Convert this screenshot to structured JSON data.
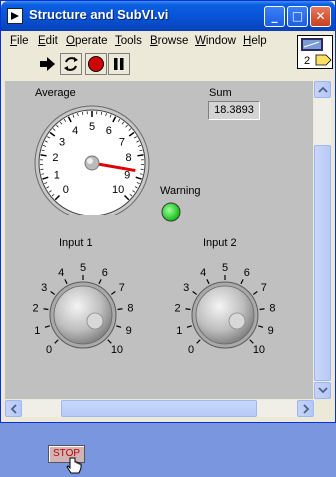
{
  "window": {
    "title": "Structure and SubVI.vi"
  },
  "title_buttons": {
    "minimize": "_",
    "maximize": "□",
    "close": "✕"
  },
  "menu": [
    {
      "label": "File",
      "accel": "F"
    },
    {
      "label": "Edit",
      "accel": "E"
    },
    {
      "label": "Operate",
      "accel": "O"
    },
    {
      "label": "Tools",
      "accel": "T"
    },
    {
      "label": "Browse",
      "accel": "B"
    },
    {
      "label": "Window",
      "accel": "W"
    },
    {
      "label": "Help",
      "accel": "H"
    }
  ],
  "toolbar": [
    "run-arrow-icon",
    "run-continuously-icon",
    "abort-icon",
    "pause-icon"
  ],
  "vi_icon": {
    "text": "2"
  },
  "panel": {
    "average_label": "Average",
    "sum_label": "Sum",
    "sum_value": "18.3893",
    "warning_label": "Warning",
    "input1_label": "Input 1",
    "input2_label": "Input 2",
    "stop_label": "STOP",
    "warning_on": true,
    "warning_color": "#22dd22"
  },
  "gauge": {
    "ticks": [
      "0",
      "1",
      "2",
      "3",
      "4",
      "5",
      "6",
      "7",
      "8",
      "9",
      "10"
    ],
    "value": 8.7,
    "needle_color": "#e00000"
  },
  "knobs": {
    "ticks": [
      "0",
      "1",
      "2",
      "3",
      "4",
      "5",
      "6",
      "7",
      "8",
      "9",
      "10"
    ]
  }
}
